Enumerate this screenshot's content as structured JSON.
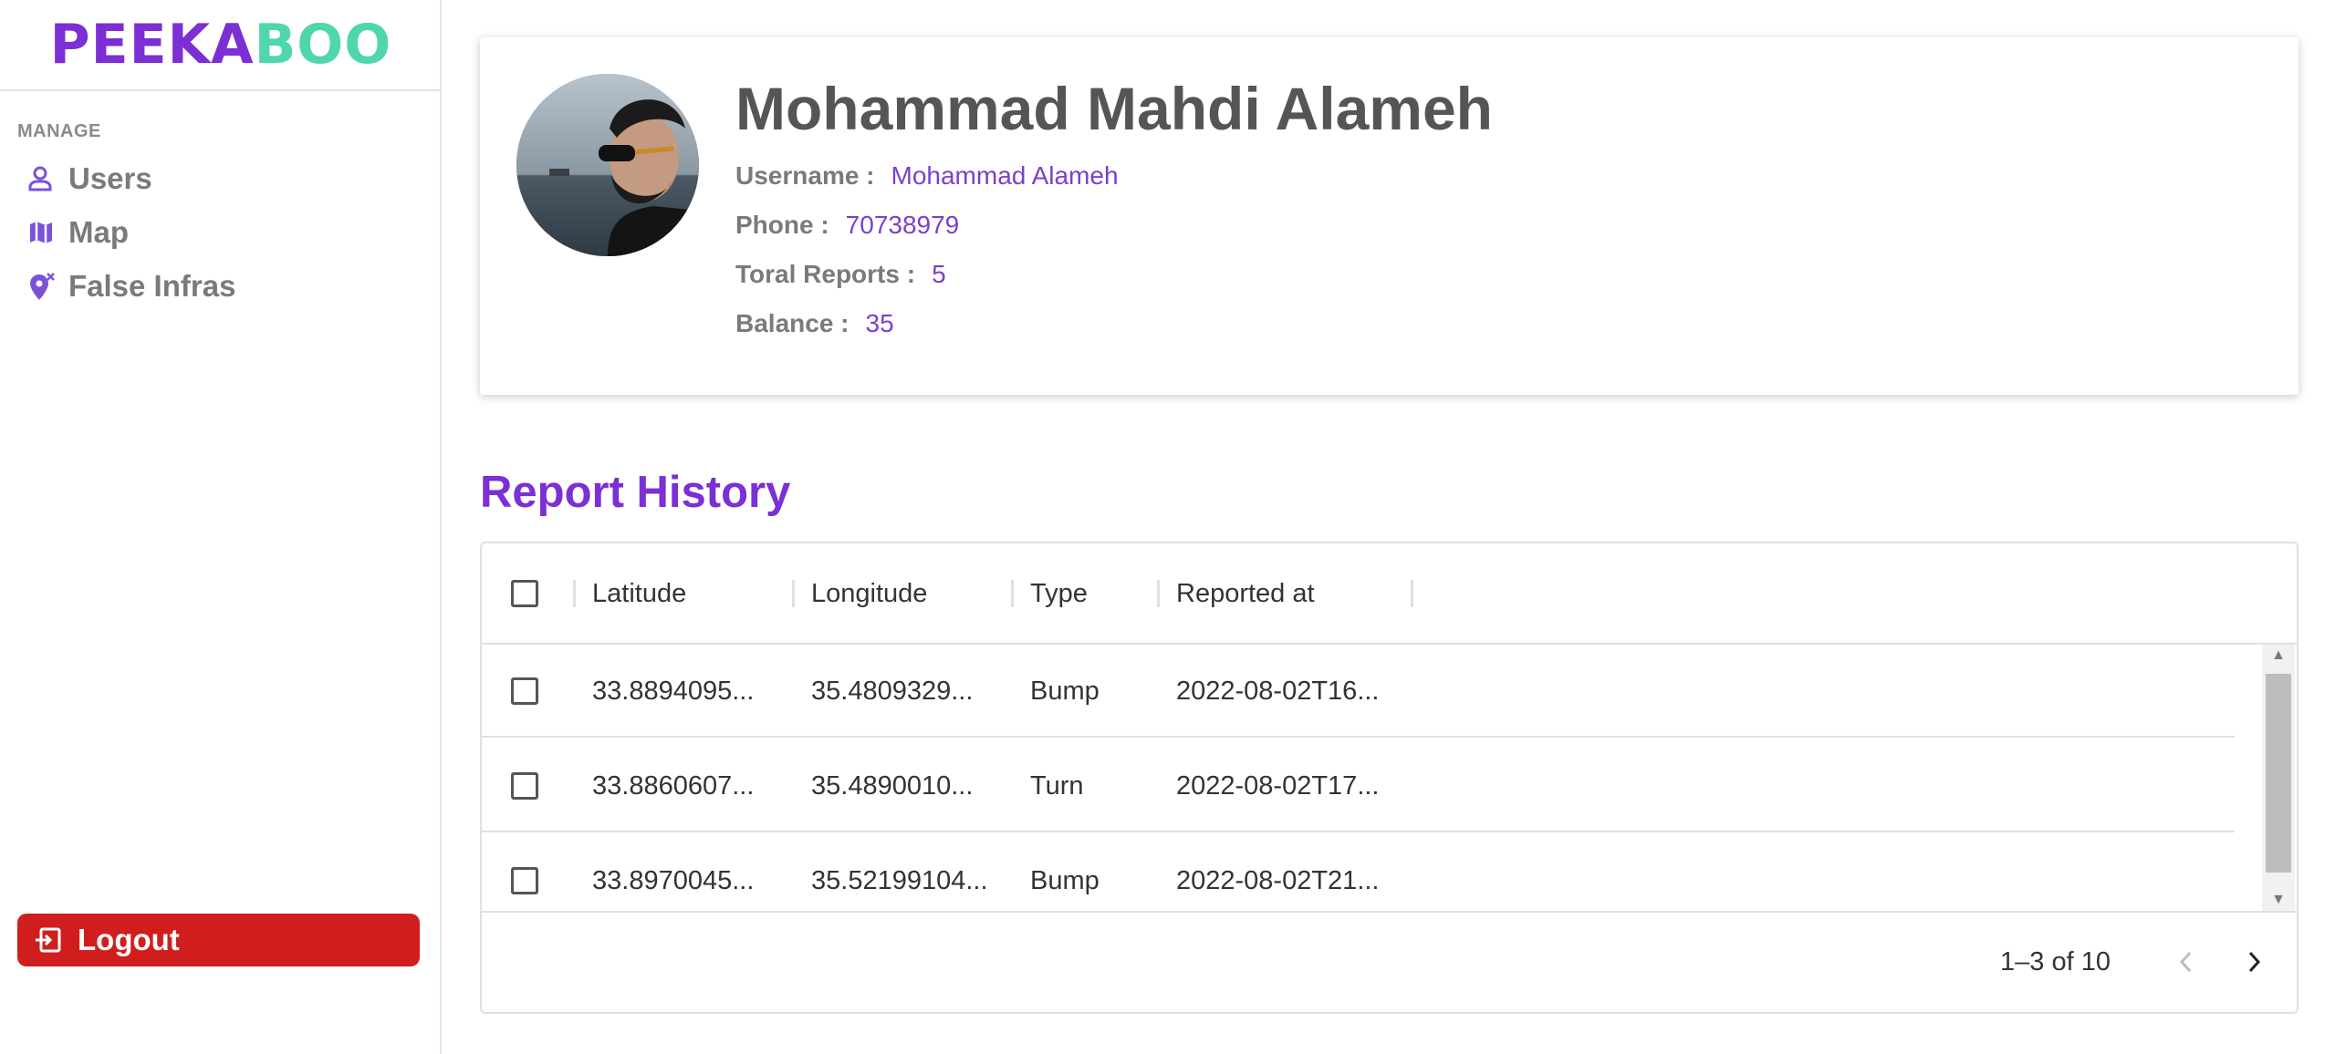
{
  "brand": {
    "part1": "PEEKA",
    "part2": "BOO"
  },
  "sidebar": {
    "section": "MANAGE",
    "items": [
      {
        "label": "Users",
        "icon": "user-icon"
      },
      {
        "label": "Map",
        "icon": "map-icon"
      },
      {
        "label": "False Infras",
        "icon": "location-x-icon"
      }
    ],
    "logout": "Logout"
  },
  "profile": {
    "name": "Mohammad Mahdi Alameh",
    "username_label": "Username :",
    "username": "Mohammad Alameh",
    "phone_label": "Phone :",
    "phone": "70738979",
    "reports_label": "Toral Reports :",
    "reports": "5",
    "balance_label": "Balance :",
    "balance": "35"
  },
  "report_history": {
    "title": "Report History",
    "columns": [
      "Latitude",
      "Longitude",
      "Type",
      "Reported at"
    ],
    "rows": [
      {
        "lat": "33.8894095...",
        "lng": "35.4809329...",
        "type": "Bump",
        "reported": "2022-08-02T16..."
      },
      {
        "lat": "33.8860607...",
        "lng": "35.4890010...",
        "type": "Turn",
        "reported": "2022-08-02T17..."
      },
      {
        "lat": "33.8970045...",
        "lng": "35.52199104...",
        "type": "Bump",
        "reported": "2022-08-02T21..."
      }
    ],
    "pagination": "1–3 of 10"
  },
  "colors": {
    "brand_purple": "#7b2fd4",
    "brand_green": "#4fd6ad",
    "logout_red": "#d01e1e"
  }
}
